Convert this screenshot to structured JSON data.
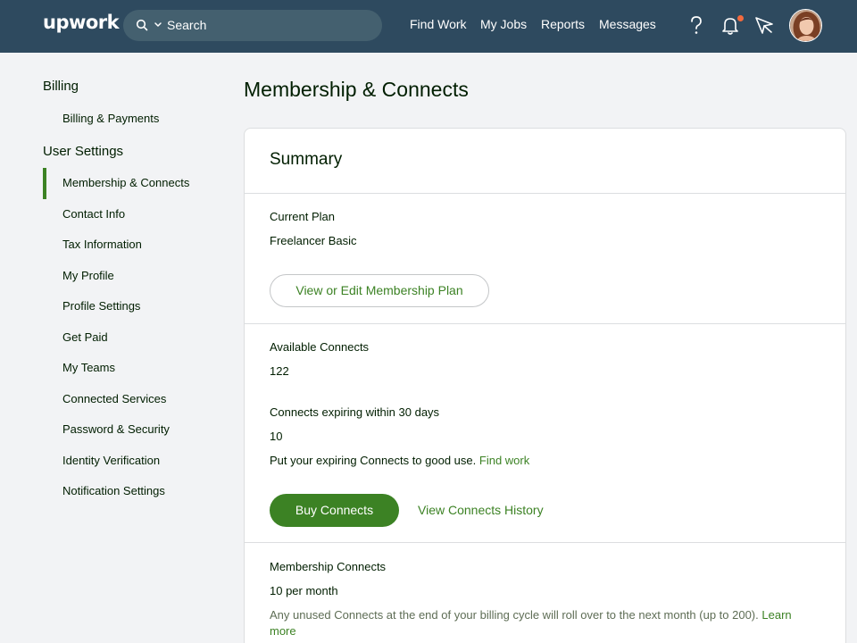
{
  "nav": {
    "logo": "upwork",
    "search_placeholder": "Search",
    "links": [
      "Find Work",
      "My Jobs",
      "Reports",
      "Messages"
    ],
    "accent": "#2e4a5f"
  },
  "sidebar": {
    "billing_heading": "Billing",
    "billing_items": [
      "Billing & Payments"
    ],
    "user_heading": "User Settings",
    "user_items": [
      "Membership & Connects",
      "Contact Info",
      "Tax Information",
      "My Profile",
      "Profile Settings",
      "Get Paid",
      "My Teams",
      "Connected Services",
      "Password & Security",
      "Identity Verification",
      "Notification Settings"
    ],
    "active_item": "Membership & Connects"
  },
  "main": {
    "title": "Membership & Connects",
    "summary": {
      "title": "Summary",
      "current_plan_label": "Current Plan",
      "current_plan_value": "Freelancer Basic",
      "edit_plan_button": "View or Edit Membership Plan",
      "available_label": "Available Connects",
      "available_value": "122",
      "expiring_label": "Connects expiring within 30 days",
      "expiring_value": "10",
      "expiring_note": "Put your expiring Connects to good use.",
      "find_work_link": "Find work",
      "buy_button": "Buy Connects",
      "history_link": "View Connects History",
      "membership_label": "Membership Connects",
      "membership_value": "10 per month",
      "rollover_note": "Any unused Connects at the end of your billing cycle will roll over to the next month (up to 200).",
      "learn_more_link": "Learn more"
    }
  },
  "colors": {
    "brand_green": "#3c8224",
    "page_bg": "#f2f3f5"
  }
}
